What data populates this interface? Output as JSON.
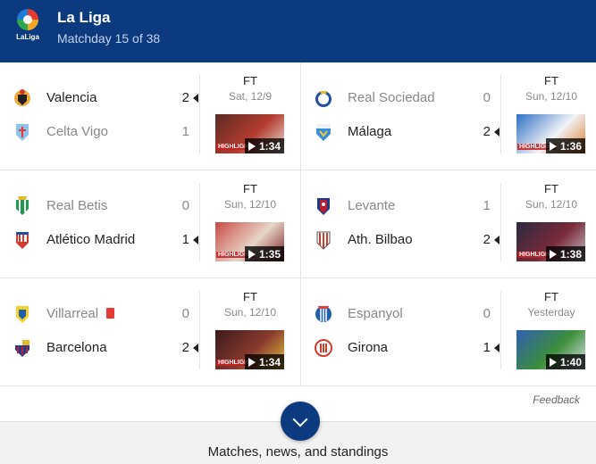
{
  "league": {
    "name": "La Liga",
    "matchday": "Matchday 15 of 38",
    "logo_text": "LaLiga",
    "logo_icon": "laliga-logo-icon"
  },
  "matches": [
    {
      "home": {
        "name": "Valencia",
        "score": "2",
        "winner": true,
        "crest": "valencia-crest-icon"
      },
      "away": {
        "name": "Celta Vigo",
        "score": "1",
        "winner": false,
        "crest": "celta-vigo-crest-icon"
      },
      "status": "FT",
      "date": "Sat, 12/9",
      "duration": "1:34",
      "highlight": "HIGHLIGHT",
      "thumb_colors": [
        "#5a2a24",
        "#b43c2e",
        "#e8e2d8"
      ]
    },
    {
      "home": {
        "name": "Real Sociedad",
        "score": "0",
        "winner": false,
        "crest": "real-sociedad-crest-icon"
      },
      "away": {
        "name": "Málaga",
        "score": "2",
        "winner": true,
        "crest": "malaga-crest-icon"
      },
      "status": "FT",
      "date": "Sun, 12/10",
      "duration": "1:36",
      "highlight": "HIGHLIGHT",
      "thumb_colors": [
        "#2d6fc4",
        "#f0f3f7",
        "#e07a2a"
      ]
    },
    {
      "home": {
        "name": "Real Betis",
        "score": "0",
        "winner": false,
        "crest": "real-betis-crest-icon"
      },
      "away": {
        "name": "Atlético Madrid",
        "score": "1",
        "winner": true,
        "crest": "atletico-madrid-crest-icon"
      },
      "status": "FT",
      "date": "Sun, 12/10",
      "duration": "1:35",
      "highlight": "HIGHLIGHT",
      "thumb_colors": [
        "#c84a44",
        "#e8d5c8",
        "#7a1e22"
      ]
    },
    {
      "home": {
        "name": "Levante",
        "score": "1",
        "winner": false,
        "crest": "levante-crest-icon"
      },
      "away": {
        "name": "Ath. Bilbao",
        "score": "2",
        "winner": true,
        "crest": "ath-bilbao-crest-icon"
      },
      "status": "FT",
      "date": "Sun, 12/10",
      "duration": "1:38",
      "highlight": "HIGHLIGHT",
      "thumb_colors": [
        "#2a2a3e",
        "#7a2a3a",
        "#c7c3c9"
      ]
    },
    {
      "home": {
        "name": "Villarreal",
        "score": "0",
        "winner": false,
        "crest": "villarreal-crest-icon",
        "red_card": true
      },
      "away": {
        "name": "Barcelona",
        "score": "2",
        "winner": true,
        "crest": "barcelona-crest-icon"
      },
      "status": "FT",
      "date": "Sun, 12/10",
      "duration": "1:34",
      "highlight": "HIGHLIGHT",
      "thumb_colors": [
        "#3a1a1a",
        "#8a3a2e",
        "#e2c23a"
      ]
    },
    {
      "home": {
        "name": "Espanyol",
        "score": "0",
        "winner": false,
        "crest": "espanyol-crest-icon"
      },
      "away": {
        "name": "Girona",
        "score": "1",
        "winner": true,
        "crest": "girona-crest-icon"
      },
      "status": "FT",
      "date": "Yesterday",
      "duration": "1:40",
      "highlight": "",
      "thumb_colors": [
        "#2e5fb0",
        "#3d8f3a",
        "#dfe6ef"
      ]
    }
  ],
  "feedback": "Feedback",
  "more": {
    "label": "Matches, news, and standings",
    "icon": "chevron-down-icon"
  },
  "colors": {
    "header_bg": "#0b3a7e",
    "red_card": "#e53935"
  }
}
